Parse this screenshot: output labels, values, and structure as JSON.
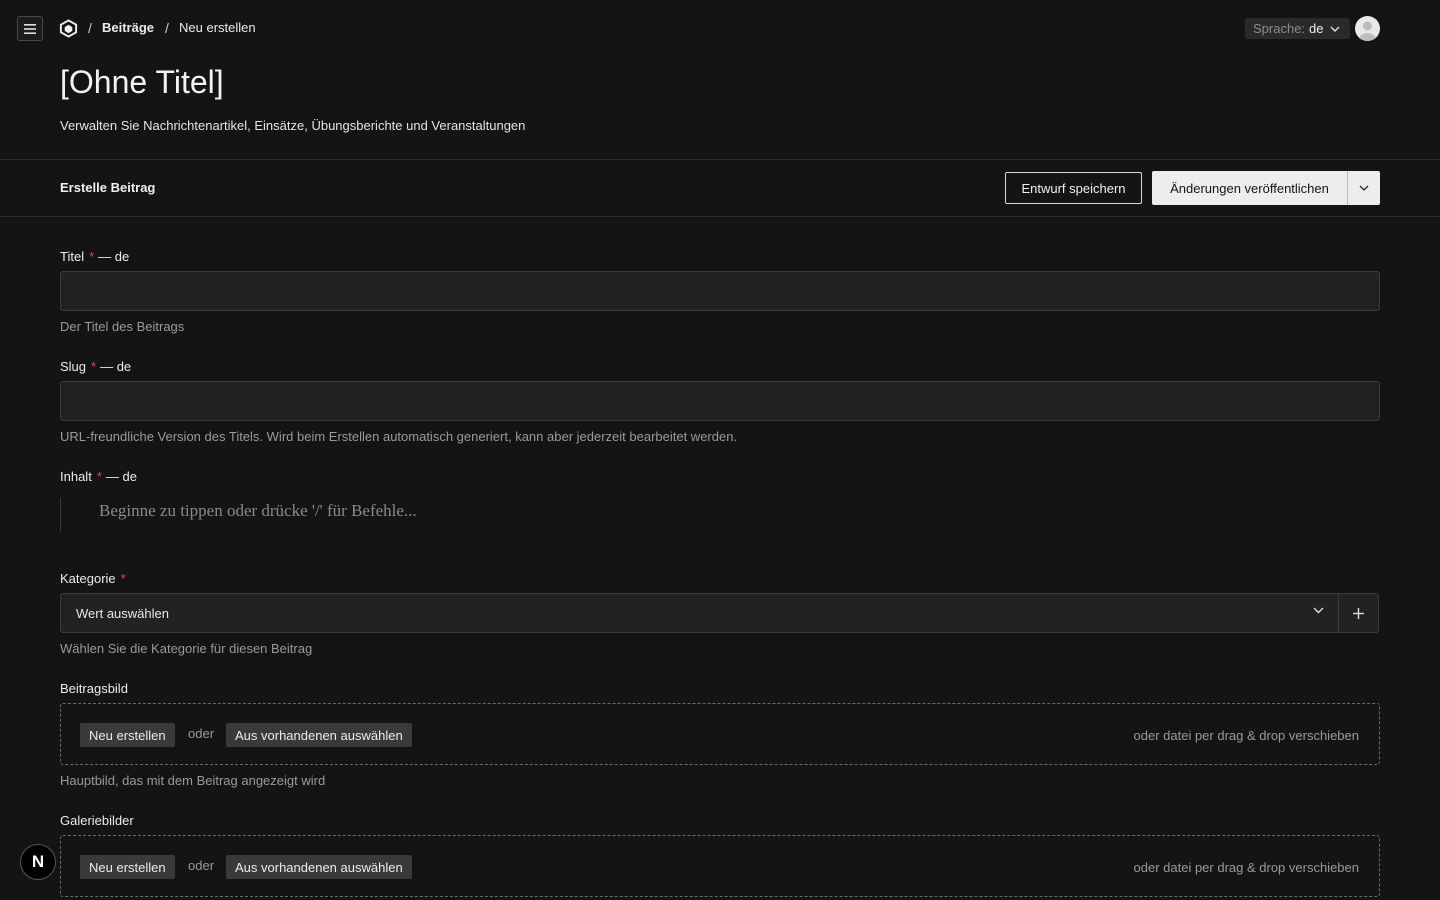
{
  "breadcrumb": {
    "items": [
      {
        "label": "Beiträge"
      },
      {
        "label": "Neu erstellen"
      }
    ],
    "separator": "/"
  },
  "language": {
    "label": "Sprache:",
    "value": "de"
  },
  "header": {
    "title": "[Ohne Titel]",
    "description": "Verwalten Sie Nachrichtenartikel, Einsätze, Übungsberichte und Veranstaltungen"
  },
  "subheader": {
    "title": "Erstelle Beitrag",
    "draft_label": "Entwurf speichern",
    "publish_label": "Änderungen veröffentlichen"
  },
  "form": {
    "required_mark": "*",
    "title": {
      "label": "Titel",
      "locale": "— de",
      "value": "",
      "hint": "Der Titel des Beitrags"
    },
    "slug": {
      "label": "Slug",
      "locale": "— de",
      "value": "",
      "hint": "URL-freundliche Version des Titels. Wird beim Erstellen automatisch generiert, kann aber jederzeit bearbeitet werden."
    },
    "content": {
      "label": "Inhalt",
      "locale": "— de",
      "placeholder": "Beginne zu tippen oder drücke '/' für Befehle..."
    },
    "category": {
      "label": "Kategorie",
      "value": "Wert auswählen",
      "hint": "Wählen Sie die Kategorie für diesen Beitrag"
    },
    "featured_image": {
      "label": "Beitragsbild",
      "create_label": "Neu erstellen",
      "or_label": "oder",
      "select_label": "Aus vorhandenen auswählen",
      "drop_label": "oder datei per drag & drop verschieben",
      "hint": "Hauptbild, das mit dem Beitrag angezeigt wird"
    },
    "gallery": {
      "label": "Galeriebilder",
      "create_label": "Neu erstellen",
      "or_label": "oder",
      "select_label": "Aus vorhandenen auswählen",
      "drop_label": "oder datei per drag & drop verschieben"
    }
  },
  "dev_badge": {
    "label": "N"
  },
  "colors": {
    "background": "#141414",
    "input_background": "#222222",
    "required": "#e0484e",
    "publish_button": "#ededed"
  },
  "icons": {
    "menu": "hamburger-icon",
    "logo": "cube-logo-icon",
    "chevron": "chevron-down-icon",
    "add": "plus-icon",
    "avatar": "user-avatar-icon"
  }
}
